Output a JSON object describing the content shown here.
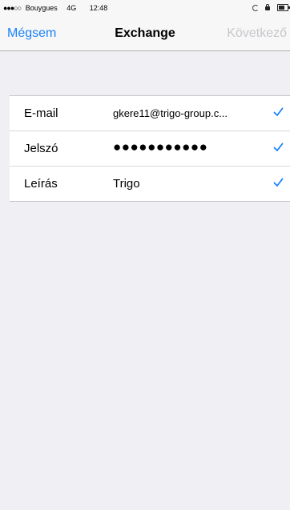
{
  "status_bar": {
    "signal_dots": "●●●○○",
    "carrier": "Bouygues",
    "network": "4G",
    "time": "12:48"
  },
  "nav": {
    "cancel_label": "Mégsem",
    "title": "Exchange",
    "next_label": "Következő"
  },
  "form": {
    "rows": [
      {
        "label": "E-mail",
        "value": "gkere11@trigo-group.c...",
        "icon": "checkmark-icon"
      },
      {
        "label": "Jelszó",
        "value": "●●●●●●●●●●●",
        "icon": "checkmark-icon"
      },
      {
        "label": "Leírás",
        "value": "Trigo",
        "icon": "checkmark-icon"
      }
    ]
  },
  "colors": {
    "accent": "#1a82fb",
    "disabled": "#c7c7cc",
    "background": "#efeff4"
  }
}
